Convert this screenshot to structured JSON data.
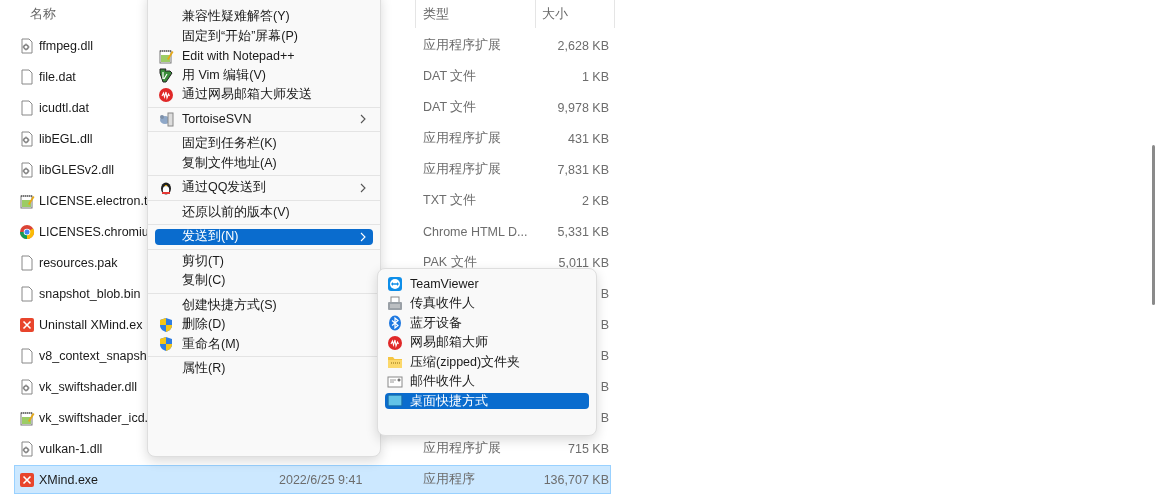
{
  "columns": [
    {
      "label": "名称"
    },
    {
      "label": "类型"
    },
    {
      "label": "大小"
    }
  ],
  "files": [
    {
      "name": "ffmpeg.dll",
      "kind": "dll",
      "type": "应用程序扩展",
      "size": "2,628 KB",
      "selected": false
    },
    {
      "name": "file.dat",
      "kind": "blank",
      "type": "DAT 文件",
      "size": "1 KB",
      "selected": false
    },
    {
      "name": "icudtl.dat",
      "kind": "blank",
      "type": "DAT 文件",
      "size": "9,978 KB",
      "selected": false
    },
    {
      "name": "libEGL.dll",
      "kind": "dll",
      "type": "应用程序扩展",
      "size": "431 KB",
      "selected": false
    },
    {
      "name": "libGLESv2.dll",
      "kind": "dll",
      "type": "应用程序扩展",
      "size": "7,831 KB",
      "selected": false
    },
    {
      "name": "LICENSE.electron.t",
      "kind": "text",
      "type": "TXT 文件",
      "size": "2 KB",
      "selected": false
    },
    {
      "name": "LICENSES.chromiu",
      "kind": "chrome",
      "type": "Chrome HTML D...",
      "size": "5,331 KB",
      "selected": false
    },
    {
      "name": "resources.pak",
      "kind": "blank",
      "type": "PAK 文件",
      "size": "5,011 KB",
      "selected": false
    },
    {
      "name": "snapshot_blob.bin",
      "kind": "blank",
      "size": "B",
      "selected": false
    },
    {
      "name": "Uninstall XMind.ex",
      "kind": "xmind",
      "size": "B",
      "selected": false
    },
    {
      "name": "v8_context_snapsh",
      "kind": "blank",
      "size": "B",
      "selected": false
    },
    {
      "name": "vk_swiftshader.dll",
      "kind": "dll",
      "size": "B",
      "selected": false
    },
    {
      "name": "vk_swiftshader_icd.",
      "kind": "text",
      "size": "B",
      "selected": false
    },
    {
      "name": "vulkan-1.dll",
      "kind": "dll",
      "type": "应用程序扩展",
      "size": "715 KB",
      "selected": false
    },
    {
      "name": "XMind.exe",
      "kind": "xmind",
      "date": "2022/6/25 9:41",
      "type": "应用程序",
      "size": "136,707 KB",
      "selected": true
    }
  ],
  "context_menu": {
    "groups": [
      [
        {
          "label": "兼容性疑难解答(Y)",
          "submenu": false,
          "selected": false
        },
        {
          "label": "固定到“开始”屏幕(P)",
          "submenu": false,
          "selected": false
        },
        {
          "label": "Edit with Notepad++",
          "kind": "notepad",
          "submenu": false,
          "selected": false
        },
        {
          "label": "用 Vim 编辑(V)",
          "kind": "vim",
          "submenu": false,
          "selected": false
        },
        {
          "label": "通过网易邮箱大师发送",
          "kind": "netease",
          "submenu": false,
          "selected": false
        }
      ],
      [
        {
          "label": "TortoiseSVN",
          "kind": "svn",
          "submenu": true,
          "selected": false
        }
      ],
      [
        {
          "label": "固定到任务栏(K)",
          "submenu": false,
          "selected": false
        },
        {
          "label": "复制文件地址(A)",
          "submenu": false,
          "selected": false
        }
      ],
      [
        {
          "label": "通过QQ发送到",
          "kind": "qq",
          "submenu": true,
          "selected": false
        }
      ],
      [
        {
          "label": "还原以前的版本(V)",
          "submenu": false,
          "selected": false
        }
      ],
      [
        {
          "label": "发送到(N)",
          "submenu": true,
          "selected": true
        }
      ],
      [
        {
          "label": "剪切(T)",
          "submenu": false,
          "selected": false
        },
        {
          "label": "复制(C)",
          "submenu": false,
          "selected": false
        }
      ],
      [
        {
          "label": "创建快捷方式(S)",
          "submenu": false,
          "selected": false
        },
        {
          "label": "删除(D)",
          "kind": "shield",
          "submenu": false,
          "selected": false
        },
        {
          "label": "重命名(M)",
          "kind": "shield",
          "submenu": false,
          "selected": false
        }
      ],
      [
        {
          "label": "属性(R)",
          "submenu": false,
          "selected": false
        }
      ]
    ]
  },
  "send_to_menu": [
    {
      "label": "TeamViewer",
      "kind": "teamviewer",
      "selected": false
    },
    {
      "label": "传真收件人",
      "kind": "fax",
      "selected": false
    },
    {
      "label": "蓝牙设备",
      "kind": "bluetooth",
      "selected": false
    },
    {
      "label": "网易邮箱大师",
      "kind": "netease",
      "selected": false
    },
    {
      "label": "压缩(zipped)文件夹",
      "kind": "zip",
      "selected": false
    },
    {
      "label": "邮件收件人",
      "kind": "mail",
      "selected": false
    },
    {
      "label": "桌面快捷方式",
      "kind": "desktop",
      "selected": true
    }
  ]
}
